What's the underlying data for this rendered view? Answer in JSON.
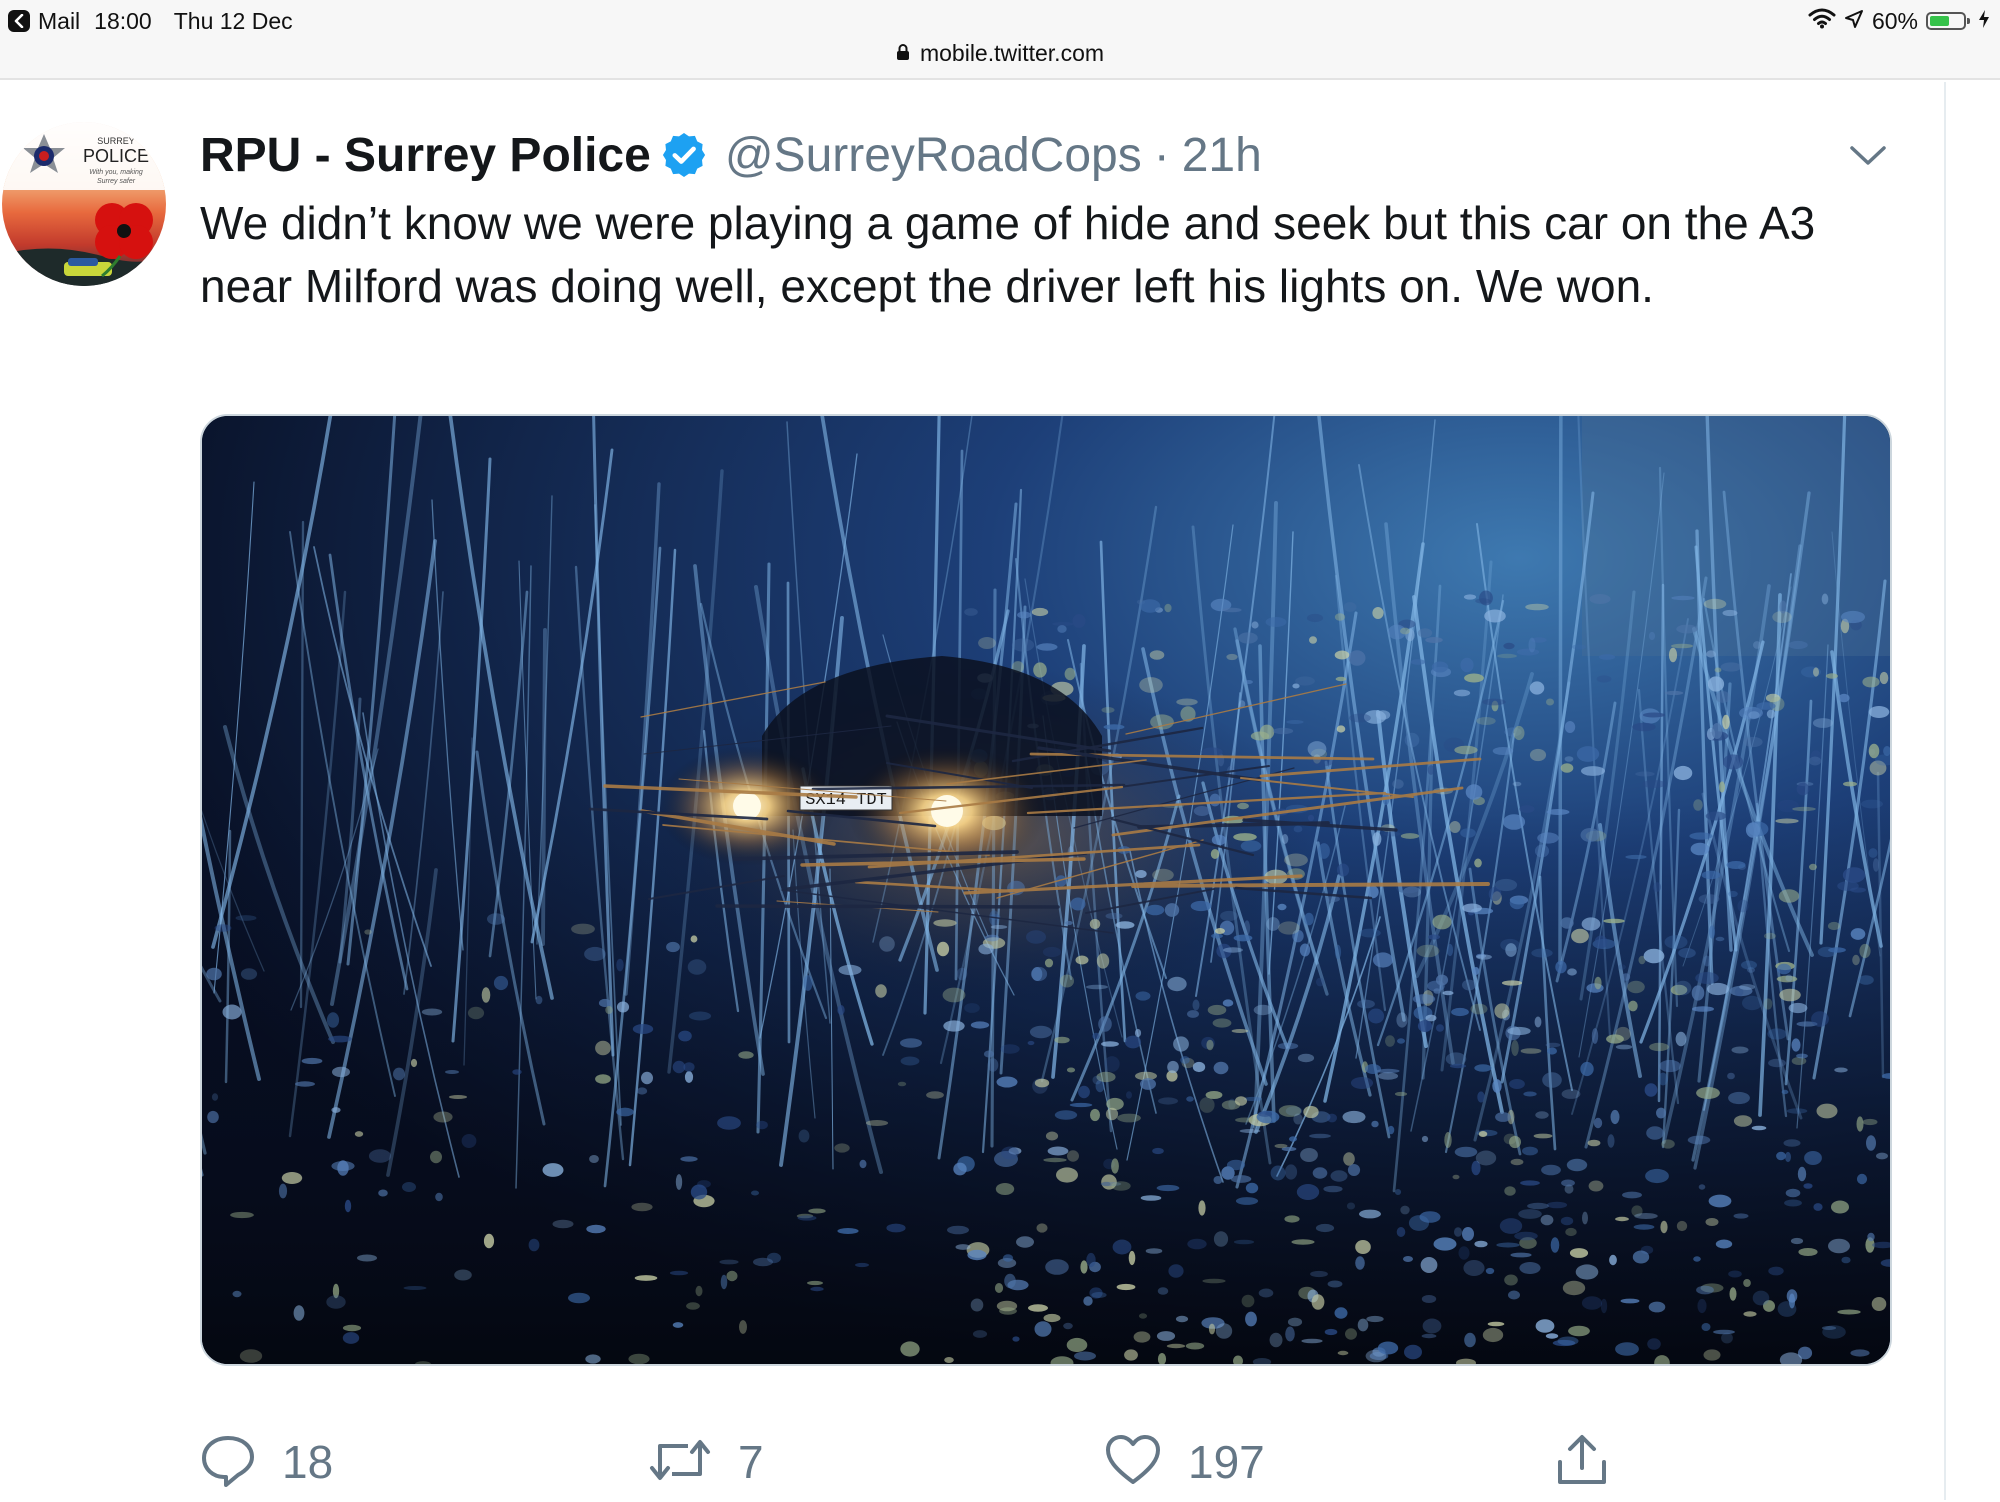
{
  "status_bar": {
    "back_app": "Mail",
    "time": "18:00",
    "date": "Thu 12 Dec",
    "battery_percent_label": "60%",
    "battery_level": 0.6,
    "url": "mobile.twitter.com"
  },
  "tweet": {
    "display_name": "RPU - Surrey Police",
    "handle": "@SurreyRoadCops",
    "separator": "·",
    "timestamp": "21h",
    "text": "We didn’t know we were playing a game of hide and seek but this car on the A3 near Milford was doing well, except the driver left his lights on. We won.",
    "avatar": {
      "top_text": "SURREY",
      "main_text": "POLICE",
      "tagline_1": "With you, making",
      "tagline_2": "Surrey safer"
    },
    "media": {
      "number_plate": "SX14 TDT"
    },
    "actions": {
      "replies": "18",
      "retweets": "7",
      "likes": "197"
    }
  },
  "colors": {
    "verified_blue": "#1da1f2",
    "secondary_text": "#657786",
    "primary_text": "#14171a",
    "poppy_red": "#d6110f"
  }
}
